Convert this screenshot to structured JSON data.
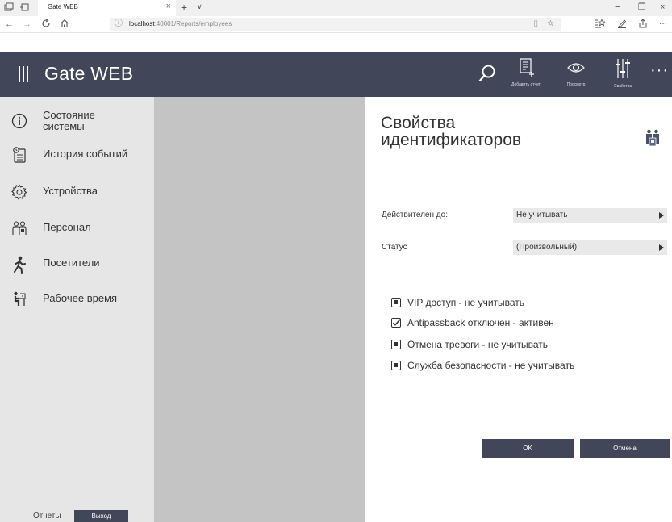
{
  "browser": {
    "tab_title": "Gate WEB",
    "tab_close": "×",
    "new_tab": "+",
    "tab_list": "∨",
    "window_controls": {
      "minimize": "−",
      "maximize": "❐",
      "close": "×"
    },
    "url_host": "localhost",
    "url_rest": ":40001/Reports/employees"
  },
  "app": {
    "title": "Gate WEB",
    "header_actions": [
      {
        "label": "Добавить отчет",
        "icon": "add-report-icon"
      },
      {
        "label": "Просмотр",
        "icon": "eye-icon"
      },
      {
        "label": "Свойства",
        "icon": "sliders-icon"
      }
    ],
    "more": "···"
  },
  "sidebar": {
    "items": [
      {
        "label": "Состояние системы",
        "icon": "info-circle-icon"
      },
      {
        "label": "История событий",
        "icon": "history-clipboard-icon"
      },
      {
        "label": "Устройства",
        "icon": "gear-icon"
      },
      {
        "label": "Персонал",
        "icon": "personnel-icon"
      },
      {
        "label": "Посетители",
        "icon": "walking-person-icon"
      },
      {
        "label": "Рабочее время",
        "icon": "person-at-desk-icon"
      }
    ],
    "footer_reports": "Отчеты",
    "footer_exit": "Выход"
  },
  "panel": {
    "title": "Свойства идентификаторов",
    "icon": "id-badge-people-icon",
    "properties": [
      {
        "label": "Действителен до:",
        "value": "Не учитывать"
      },
      {
        "label": "Статус",
        "value": "(Произвольный)"
      }
    ],
    "checkboxes": [
      {
        "label": "VIP доступ - не учитывать",
        "state": "indeterminate"
      },
      {
        "label": "Antipassback отключен - активен",
        "state": "checked"
      },
      {
        "label": "Отмена тревоги - не учитывать",
        "state": "indeterminate"
      },
      {
        "label": "Служба безопасности - не учитывать",
        "state": "indeterminate"
      }
    ],
    "ok_label": "OK",
    "cancel_label": "Отмена"
  },
  "colors": {
    "header_bg": "#414659",
    "sidebar_bg": "#e6e6e6",
    "content_gray": "#c4c4c4",
    "select_bg": "#e9e9e9"
  }
}
